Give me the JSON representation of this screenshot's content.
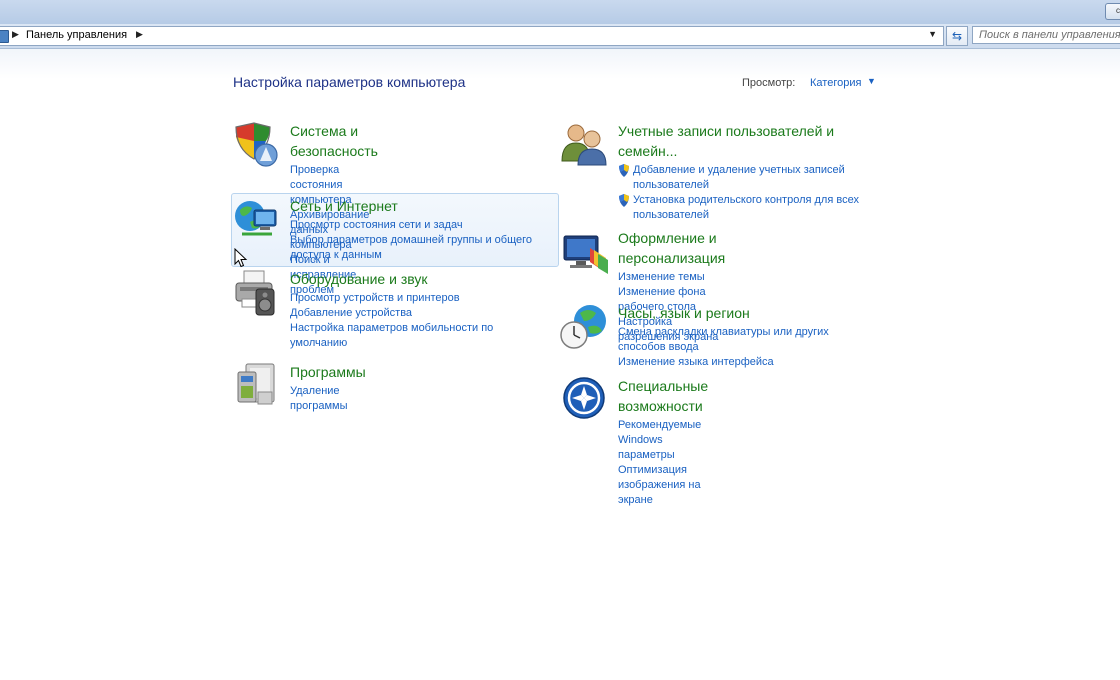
{
  "window": {
    "control_glyph": "c"
  },
  "address_bar": {
    "breadcrumb": "Панель управления",
    "search_placeholder": "Поиск в панели управления"
  },
  "page": {
    "title": "Настройка параметров компьютера",
    "view_label": "Просмотр:",
    "view_value": "Категория"
  },
  "categories": [
    {
      "title": "Система и безопасность",
      "icon": "security-shield-icon",
      "links": [
        "Проверка состояния компьютера",
        "Архивирование данных компьютера",
        "Поиск и исправление проблем"
      ]
    },
    {
      "title": "Сеть и Интернет",
      "icon": "network-globe-icon",
      "links": [
        "Просмотр состояния сети и задач",
        "Выбор параметров домашней группы и общего доступа к данным"
      ]
    },
    {
      "title": "Оборудование и звук",
      "icon": "printer-icon",
      "links": [
        "Просмотр устройств и принтеров",
        "Добавление устройства",
        "Настройка параметров мобильности по умолчанию"
      ]
    },
    {
      "title": "Программы",
      "icon": "programs-icon",
      "links": [
        "Удаление программы"
      ]
    },
    {
      "title": "Учетные записи пользователей и семейн...",
      "icon": "users-icon",
      "links": [
        "Добавление и удаление учетных записей пользователей",
        "Установка родительского контроля для всех пользователей"
      ]
    },
    {
      "title": "Оформление и персонализация",
      "icon": "personalization-icon",
      "links": [
        "Изменение темы",
        "Изменение фона рабочего стола",
        "Настройка разрешения экрана"
      ]
    },
    {
      "title": "Часы, язык и регион",
      "icon": "clock-globe-icon",
      "links": [
        "Смена раскладки клавиатуры или других способов ввода",
        "Изменение языка интерфейса"
      ]
    },
    {
      "title": "Специальные возможности",
      "icon": "accessibility-icon",
      "links": [
        "Рекомендуемые Windows параметры",
        "Оптимизация изображения на экране"
      ]
    }
  ],
  "colors": {
    "category_title": "#1b7a1b",
    "link": "#1a61c2",
    "page_title": "#1e3287"
  }
}
